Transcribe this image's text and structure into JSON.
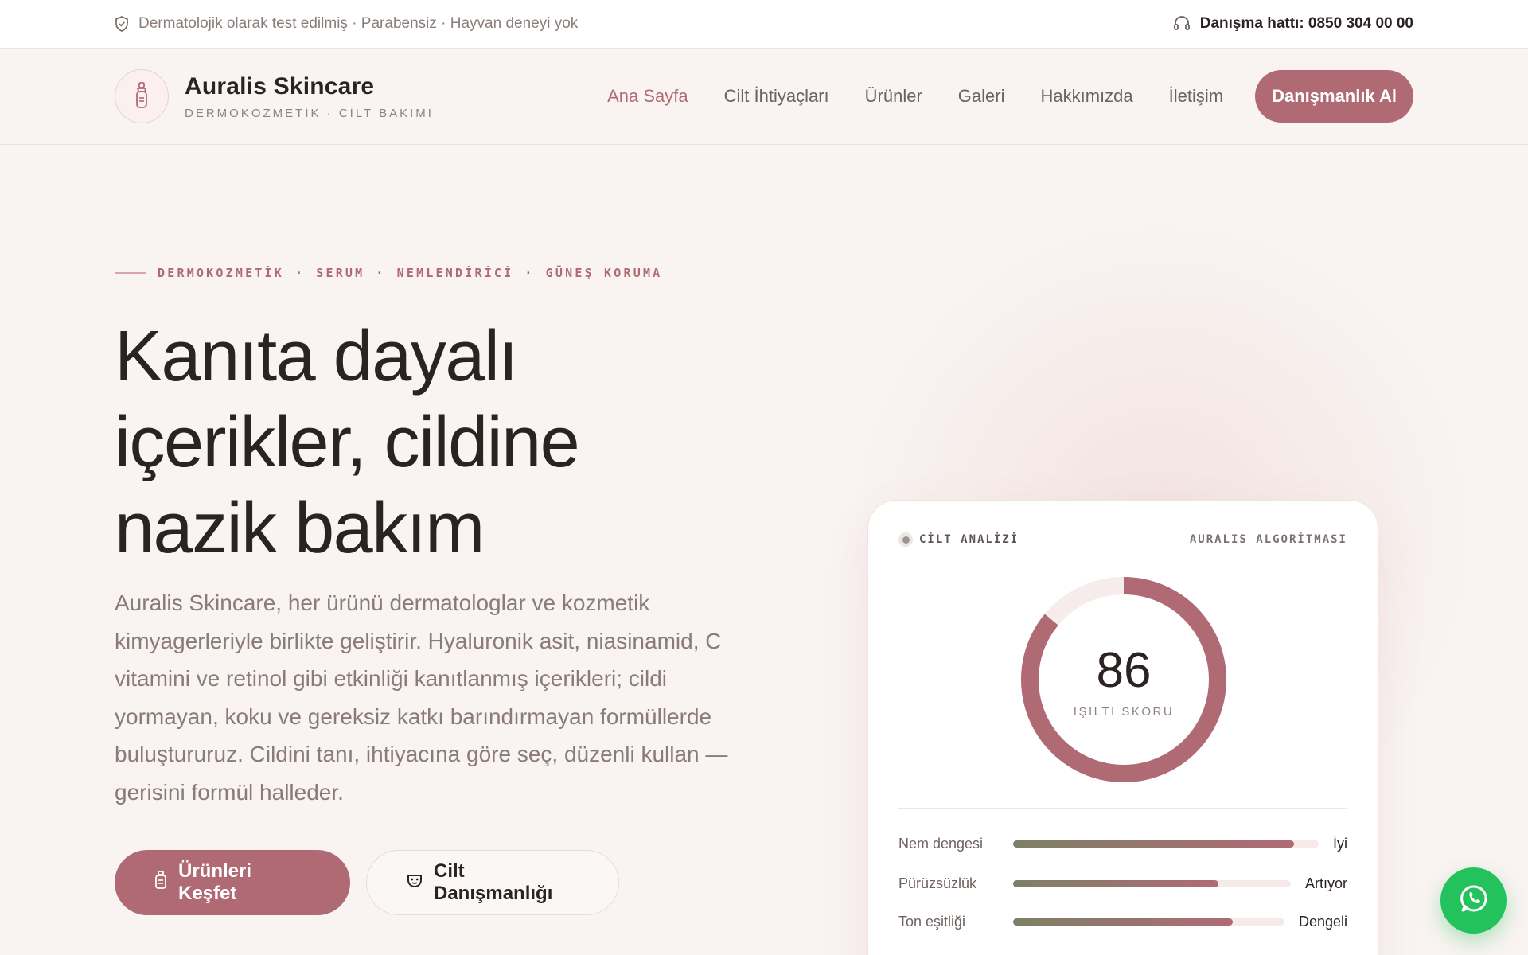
{
  "topbar": {
    "trust_text": "Dermatolojik olarak test edilmiş · Parabensiz · Hayvan deneyi yok",
    "hotline": "Danışma hattı: 0850 304 00 00"
  },
  "brand": {
    "name": "Auralis Skincare",
    "tagline": "DERMOKOZMETİK · CİLT BAKIMI"
  },
  "nav": {
    "items": [
      {
        "label": "Ana Sayfa",
        "active": true
      },
      {
        "label": "Cilt İhtiyaçları"
      },
      {
        "label": "Ürünler"
      },
      {
        "label": "Galeri"
      },
      {
        "label": "Hakkımızda"
      },
      {
        "label": "İletişim"
      }
    ],
    "cta": "Danışmanlık Al"
  },
  "hero": {
    "eyebrow": [
      "DERMOKOZMETİK",
      "SERUM",
      "NEMLENDİRİCİ",
      "GÜNEŞ KORUMA"
    ],
    "eyebrow_sep": "·",
    "headline": [
      "Kanıta dayalı",
      "içerikler, cildine",
      "nazik bakım"
    ],
    "lead": "Auralis Skincare, her ürünü dermatologlar ve kozmetik kimyagerleriyle birlikte geliştirir. Hyaluronik asit, niasinamid, C vitamini ve retinol gibi etkinliği kanıtlanmış içerikleri; cildi yormayan, koku ve gereksiz katkı barındırmayan formüllerde buluştururuz. Cildini tanı, ihtiyacına göre seç, düzenli kullan — gerisini formül halleder.",
    "primary_button": "Ürünleri Keşfet",
    "secondary_button": "Cilt Danışmanlığı"
  },
  "analysis": {
    "label": "CİLT ANALİZİ",
    "source": "AURALIS ALGORİTMASI",
    "score": "86",
    "score_fraction": 0.86,
    "score_caption": "IŞILTI SKORU",
    "metrics": [
      {
        "name": "Nem dengesi",
        "level": 0.92,
        "value": "İyi"
      },
      {
        "name": "Pürüzsüzlük",
        "level": 0.74,
        "value": "Artıyor"
      },
      {
        "name": "Ton eşitliği",
        "level": 0.81,
        "value": "Dengeli"
      }
    ]
  },
  "colors": {
    "accent": "#b06a74",
    "background": "#f9f3f1",
    "whatsapp": "#24c25d",
    "metric_gradient_start": "#7d8066"
  },
  "icons": {
    "trust": "shield-check-icon",
    "hotline": "headset-icon",
    "brand": "dropper-bottle-icon",
    "primary_button": "bottle-icon",
    "secondary_button": "face-mask-icon",
    "chat": "whatsapp-icon"
  }
}
